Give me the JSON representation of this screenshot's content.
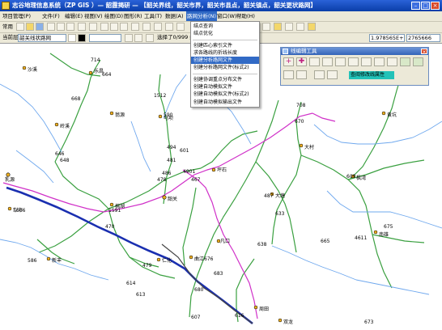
{
  "window": {
    "title": "志谷地理信息系统（ZP GIS ）— 韶霞揭研 — 【韶关界线，韶关市界，韶关市县点，韶关镇点，韶关更状路网】"
  },
  "menubar": {
    "items": [
      "项目管理(P)",
      "文件(F)",
      "编辑(E)",
      "视图(V)",
      "绘图(D)",
      "图形(R)",
      "工具(T)",
      "数据(A)",
      "路网分析(N)",
      "窗口(W)",
      "帮助(H)"
    ]
  },
  "toolbar": {
    "left_label": "常用",
    "scale_label": "当前层",
    "layer_value": "韶关线状路网",
    "select_status": "选择了0/999 线",
    "coord_x": "1.978565E+07",
    "coord_y": "2765666"
  },
  "route_menu": {
    "items": [
      {
        "label": "结点查询",
        "selected": false
      },
      {
        "label": "结点优化",
        "selected": false
      },
      {
        "label": "创建匹心索引文件",
        "selected": false
      },
      {
        "label": "求各路线的折线长度",
        "selected": false
      },
      {
        "label": "创建分析路网文件",
        "selected": true
      },
      {
        "label": "创建分析路网文件(标式2)",
        "selected": false
      },
      {
        "label": "创建协调重点分布文件",
        "selected": false
      },
      {
        "label": "创建自动模拟文件",
        "selected": false
      },
      {
        "label": "创建自动模拟文件(标式2)",
        "selected": false
      },
      {
        "label": "创建自动模拟输出文件",
        "selected": false
      }
    ]
  },
  "line_edit_panel": {
    "title": "线编辑工具",
    "field_text": "查阅修改线属性"
  },
  "map": {
    "places": [
      "乳源",
      "韶关",
      "始兴",
      "曲江",
      "南雄",
      "仁化",
      "翁源",
      "乐昌",
      "新丰",
      "马坝",
      "大塘",
      "坪石",
      "重阳",
      "沙坪",
      "周田",
      "沙溪",
      "枫湾",
      "白土",
      "官渡",
      "马市",
      "大桥",
      "大村",
      "岭溪",
      "凡口",
      "棉湖",
      "犁市",
      "双龙",
      "黄坑",
      "城口",
      "大坑",
      "帽峰"
    ],
    "road_numbers": [
      "714",
      "664",
      "668",
      "646",
      "648",
      "651",
      "673",
      "708",
      "581",
      "492",
      "586",
      "1512",
      "590",
      "494",
      "601",
      "481",
      "478",
      "467",
      "486",
      "448",
      "4901",
      "487",
      "614",
      "613",
      "616",
      "1591",
      "470",
      "472",
      "676",
      "479",
      "683",
      "680",
      "606",
      "607",
      "638",
      "670",
      "633",
      "609",
      "665",
      "447",
      "448",
      "4611",
      "675",
      "673"
    ]
  }
}
